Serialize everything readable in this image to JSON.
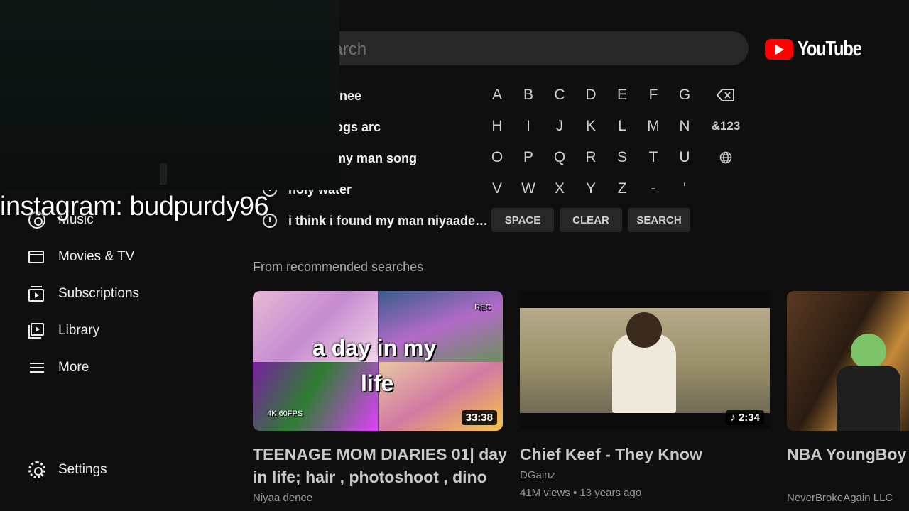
{
  "search": {
    "placeholder": "Search"
  },
  "logo": {
    "text": "YouTube"
  },
  "suggestions": [
    "niyaa denee",
    "niyaa vlogs arc",
    "i found my man song",
    "holy water",
    "i think i found my man niyaade…"
  ],
  "keyboard": {
    "rows": [
      [
        "A",
        "B",
        "C",
        "D",
        "E",
        "F",
        "G"
      ],
      [
        "H",
        "I",
        "J",
        "K",
        "L",
        "M",
        "N"
      ],
      [
        "O",
        "P",
        "Q",
        "R",
        "S",
        "T",
        "U"
      ],
      [
        "V",
        "W",
        "X",
        "Y",
        "Z",
        "-",
        "'"
      ]
    ],
    "backspace_icon": "backspace-icon",
    "symbols_label": "&123",
    "language_icon": "globe-icon",
    "space_label": "SPACE",
    "clear_label": "CLEAR",
    "search_label": "SEARCH"
  },
  "overlay": {
    "text": "instagram: budpurdy96"
  },
  "sidebar": {
    "items": [
      {
        "label": "Music",
        "icon": "music-icon"
      },
      {
        "label": "Movies & TV",
        "icon": "movies-icon"
      },
      {
        "label": "Subscriptions",
        "icon": "subscriptions-icon"
      },
      {
        "label": "Library",
        "icon": "library-icon"
      },
      {
        "label": "More",
        "icon": "menu-icon"
      }
    ],
    "settings": {
      "label": "Settings",
      "icon": "gear-icon"
    }
  },
  "section": {
    "title": "From recommended searches"
  },
  "videos": [
    {
      "title": "TEENAGE MOM DIARIES 01| day in life; hair , photoshoot , dino",
      "channel": "Niyaa denee",
      "meta": "",
      "duration": "33:38",
      "thumb_text_1": "a day in my",
      "thumb_text_2": "life",
      "thumb_badge_rec": "REC",
      "thumb_badge_4k": "4K 60FPS"
    },
    {
      "title": "Chief Keef - They Know",
      "channel": "DGainz",
      "meta": "41M views • 13 years ago",
      "duration": "2:34",
      "duration_icon": "music-note-icon"
    },
    {
      "title": "NBA YoungBoy - Freestyle (Music",
      "channel": "NeverBrokeAgain LLC",
      "meta": ""
    }
  ],
  "colors": {
    "brand_red": "#ff0000",
    "background": "#0f0f0f",
    "key_bg": "#272727"
  }
}
